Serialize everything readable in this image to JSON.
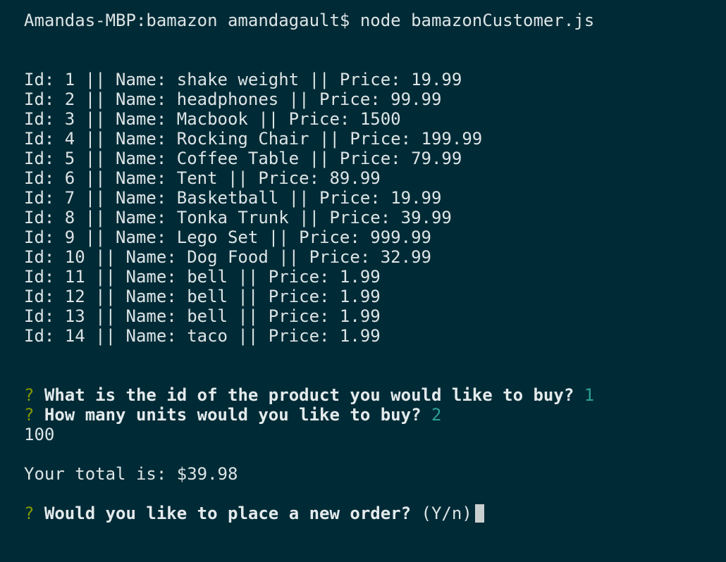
{
  "terminal": {
    "prompt": "Amandas-MBP:bamazon amandagault$ node bamazonCustomer.js",
    "products": [
      {
        "line": "Id: 1 || Name: shake weight || Price: 19.99"
      },
      {
        "line": "Id: 2 || Name: headphones || Price: 99.99"
      },
      {
        "line": "Id: 3 || Name: Macbook || Price: 1500"
      },
      {
        "line": "Id: 4 || Name: Rocking Chair || Price: 199.99"
      },
      {
        "line": "Id: 5 || Name: Coffee Table || Price: 79.99"
      },
      {
        "line": "Id: 6 || Name: Tent || Price: 89.99"
      },
      {
        "line": "Id: 7 || Name: Basketball || Price: 19.99"
      },
      {
        "line": "Id: 8 || Name: Tonka Trunk || Price: 39.99"
      },
      {
        "line": "Id: 9 || Name: Lego Set || Price: 999.99"
      },
      {
        "line": "Id: 10 || Name: Dog Food || Price: 32.99"
      },
      {
        "line": "Id: 11 || Name: bell || Price: 1.99"
      },
      {
        "line": "Id: 12 || Name: bell || Price: 1.99"
      },
      {
        "line": "Id: 13 || Name: bell || Price: 1.99"
      },
      {
        "line": "Id: 14 || Name: taco || Price: 1.99"
      }
    ],
    "question_mark": "?",
    "q1": {
      "text": "What is the id of the product you would like to buy?",
      "answer": "1"
    },
    "q2": {
      "text": "How many units would you like to buy?",
      "answer": "2"
    },
    "stock_output": "100",
    "total": "Your total is: $39.98",
    "q3": {
      "text": "Would you like to place a new order?",
      "hint": "(Y/n)"
    }
  }
}
